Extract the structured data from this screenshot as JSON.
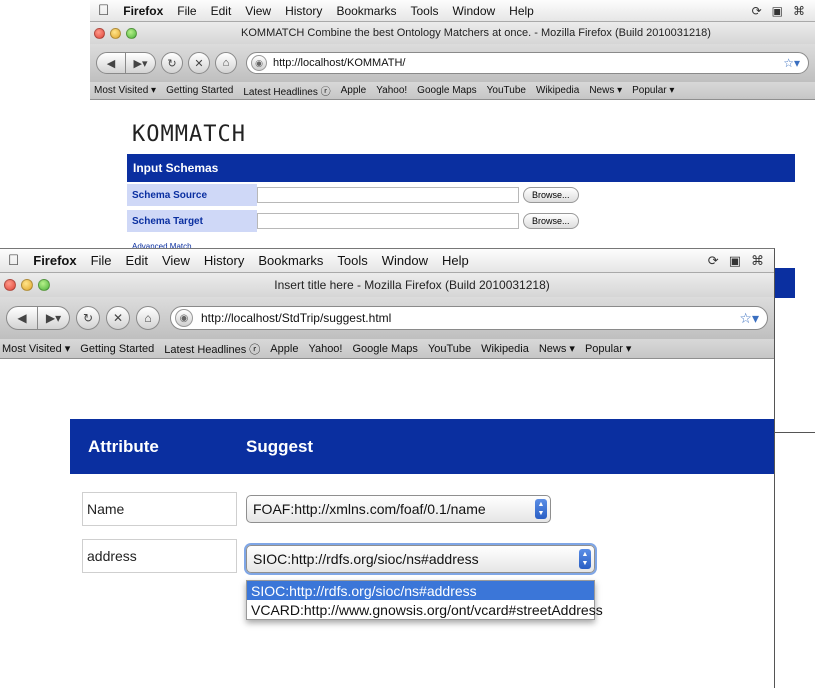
{
  "background_window": {
    "menubar": {
      "app": "Firefox",
      "items": [
        "File",
        "Edit",
        "View",
        "History",
        "Bookmarks",
        "Tools",
        "Window",
        "Help"
      ]
    },
    "title": "KOMMATCH Combine the best Ontology Matchers at once. - Mozilla Firefox (Build 2010031218)",
    "url": "http://localhost/KOMMATH/",
    "bookmarks": [
      "Most Visited ▾",
      "Getting Started",
      "Latest Headlines ⓡ",
      "Apple",
      "Yahoo!",
      "Google Maps",
      "YouTube",
      "Wikipedia",
      "News ▾",
      "Popular ▾"
    ],
    "page": {
      "logo": "KOMMATCH",
      "section_header": "Input Schemas",
      "rows": [
        {
          "label": "Schema Source",
          "button": "Browse..."
        },
        {
          "label": "Schema Target",
          "button": "Browse..."
        }
      ],
      "advanced_link": "Advanced Match"
    }
  },
  "foreground_window": {
    "menubar": {
      "app": "Firefox",
      "items": [
        "File",
        "Edit",
        "View",
        "History",
        "Bookmarks",
        "Tools",
        "Window",
        "Help"
      ]
    },
    "title": "Insert title here - Mozilla Firefox (Build 2010031218)",
    "url": "http://localhost/StdTrip/suggest.html",
    "bookmarks": [
      "Most Visited ▾",
      "Getting Started",
      "Latest Headlines ⓡ",
      "Apple",
      "Yahoo!",
      "Google Maps",
      "YouTube",
      "Wikipedia",
      "News ▾",
      "Popular ▾"
    ],
    "page": {
      "header_attribute": "Attribute",
      "header_suggest": "Suggest",
      "rows": [
        {
          "attribute": "Name",
          "suggestion": "FOAF:http://xmlns.com/foaf/0.1/name"
        },
        {
          "attribute": "address",
          "suggestion": "SIOC:http://rdfs.org/sioc/ns#address"
        }
      ],
      "dropdown_options": [
        "SIOC:http://rdfs.org/sioc/ns#address",
        "VCARD:http://www.gnowsis.org/ont/vcard#streetAddress"
      ],
      "dropdown_selected_index": 0
    }
  },
  "colors": {
    "header_blue": "#0a2fa0",
    "label_bg": "#cfd8f7",
    "selection_blue": "#3b76d8"
  }
}
